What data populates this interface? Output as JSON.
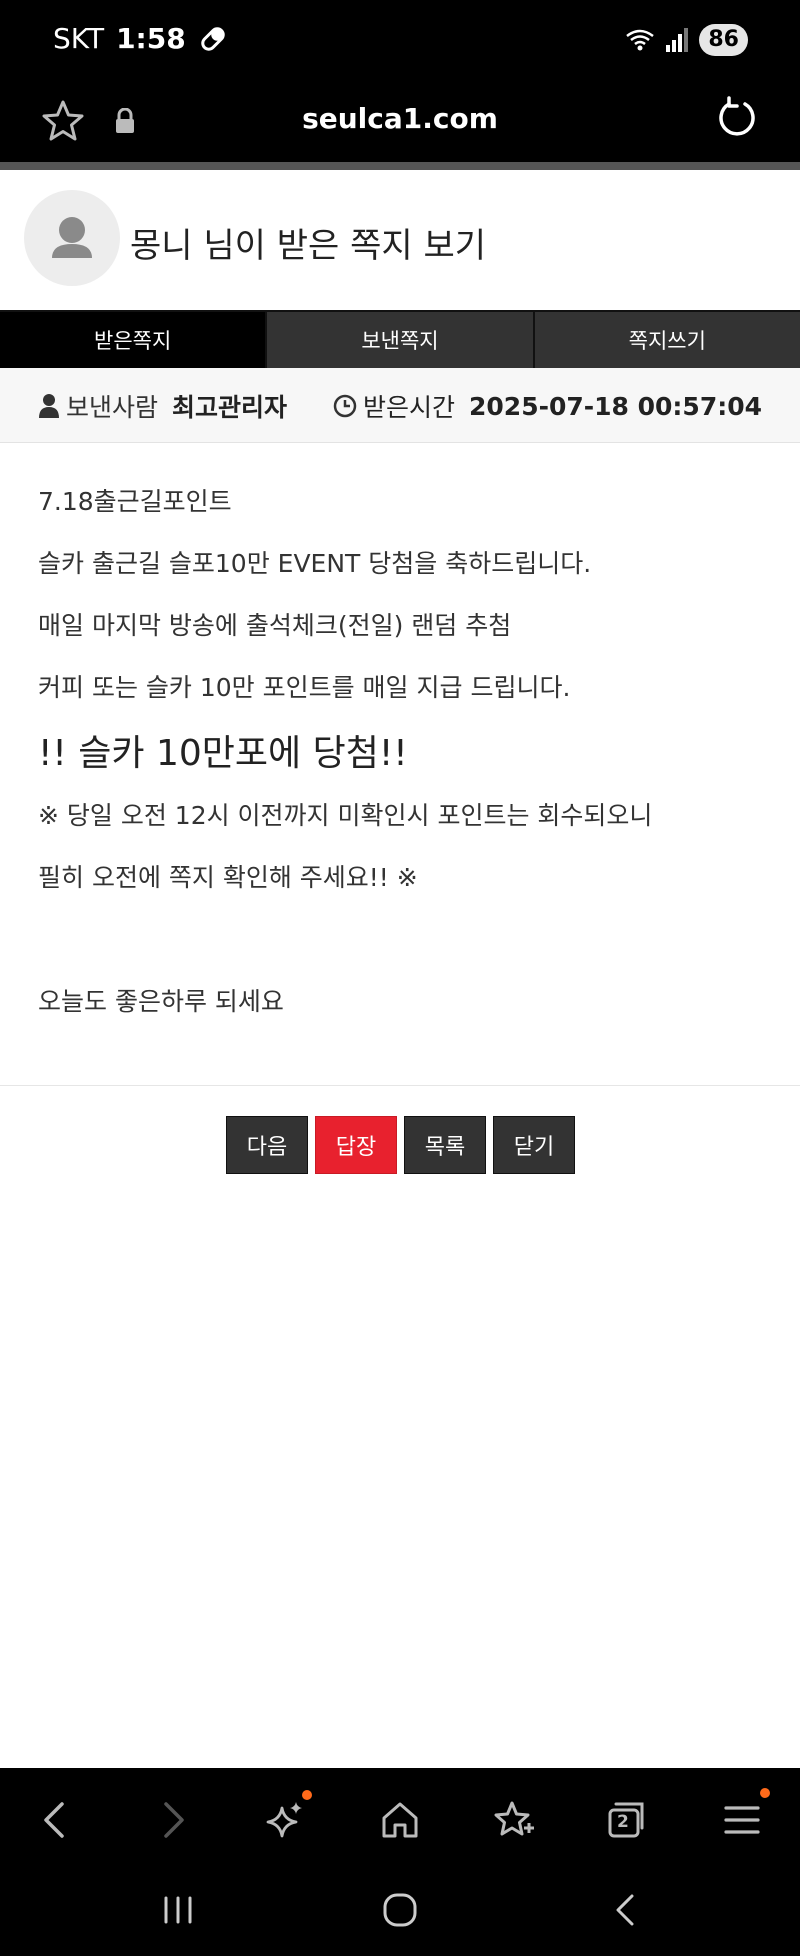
{
  "status_bar": {
    "carrier": "SKT",
    "time": "1:58",
    "battery": "86"
  },
  "browser": {
    "url": "seulca1.com"
  },
  "page": {
    "title": "몽니 님이 받은 쪽지 보기"
  },
  "tabs": [
    {
      "label": "받은쪽지",
      "active": true
    },
    {
      "label": "보낸쪽지",
      "active": false
    },
    {
      "label": "쪽지쓰기",
      "active": false
    }
  ],
  "info": {
    "sender_label": "보낸사람",
    "sender_value": "최고관리자",
    "received_label": "받은시간",
    "received_value": "2025-07-18 00:57:04"
  },
  "message": {
    "lines": [
      "7.18출근길포인트",
      "슬카 출근길 슬포10만 EVENT 당첨을 축하드립니다.",
      "매일 마지막 방송에 출석체크(전일) 랜덤 추첨",
      "커피 또는 슬카 10만 포인트를 매일 지급 드립니다.",
      "!! 슬카 10만포에 당첨!!",
      "※ 당일 오전 12시 이전까지 미확인시 포인트는 회수되오니",
      "필히 오전에 쪽지 확인해 주세요!! ※",
      "",
      "오늘도 좋은하루 되세요"
    ]
  },
  "actions": {
    "next": "다음",
    "reply": "답장",
    "list": "목록",
    "close": "닫기"
  },
  "tabs_count": "2",
  "colors": {
    "accent": "#e8212e",
    "notification_dot": "#ff6a1a"
  }
}
